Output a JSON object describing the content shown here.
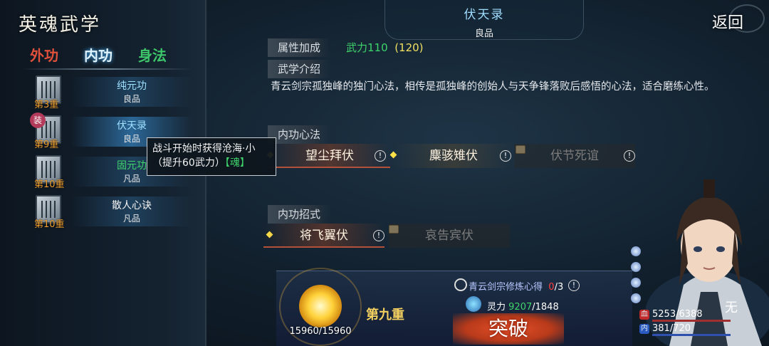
{
  "header": {
    "title": "英魂武学",
    "back_label": "返回"
  },
  "tabs": [
    {
      "label": "外功"
    },
    {
      "label": "内功"
    },
    {
      "label": "身法"
    }
  ],
  "skills": [
    {
      "name": "纯元功",
      "grade": "良品",
      "level": "第3重"
    },
    {
      "name": "伏天录",
      "grade": "良品",
      "level": "第9重",
      "equipped_mark": "装"
    },
    {
      "name": "固元功",
      "grade": "凡品",
      "level": "第10重"
    },
    {
      "name": "散人心诀",
      "grade": "凡品",
      "level": "第10重"
    }
  ],
  "tooltip": {
    "line1": "战斗开始时获得沧海·小",
    "line2_a": "（提升60武力）",
    "line2_b": "【魂】"
  },
  "detail": {
    "title": "伏天录",
    "grade": "良品",
    "attr_label": "属性加成",
    "attr_value": "武力110",
    "attr_value_next": "(120)",
    "intro_label": "武学介绍",
    "intro_text": "青云剑宗孤独峰的独门心法，相传是孤独峰的创始人与天争锋落败后感悟的心法，适合磨练心性。",
    "methods_label": "内功心法",
    "methods": [
      "望尘拜伏",
      "麋骇雉伏",
      "伏节死谊"
    ],
    "moves_label": "内功招式",
    "moves": [
      "将飞翼伏",
      "哀告宾伏"
    ]
  },
  "progress": {
    "orb_value": "15960/15960",
    "stage": "第九重",
    "heart_label": "青云剑宗修炼心得",
    "heart_have": "0",
    "heart_need": "/3",
    "ling_label": "灵力",
    "ling_have": "9207",
    "ling_need": "/1848",
    "break_label": "突破"
  },
  "character": {
    "hp": "5253/6388",
    "mp": "381/720",
    "hp_icon": "血",
    "mp_icon": "内",
    "weapon_mark": "无"
  },
  "colors": {
    "accent_green": "#3fd46c",
    "accent_red": "#e0503a",
    "gold": "#f0a030"
  }
}
